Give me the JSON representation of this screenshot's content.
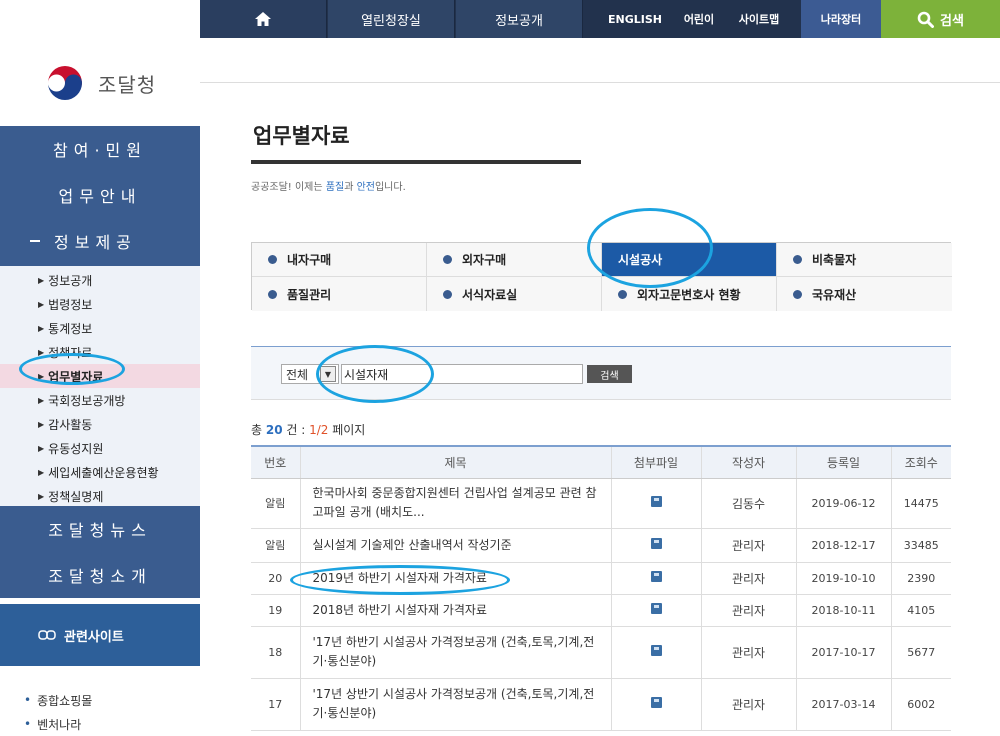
{
  "topbar": {
    "tabs": [
      "열린청장실",
      "정보공개"
    ],
    "links": [
      "ENGLISH",
      "어린이",
      "사이트맵"
    ],
    "narajangteo": "나라장터",
    "search": "검색"
  },
  "sidebar": {
    "logo_text": "조달청",
    "main_nav": [
      "참여·민원",
      "업무안내",
      "정보제공"
    ],
    "sub_items": [
      "정보공개",
      "법령정보",
      "통계정보",
      "정책자료",
      "업무별자료",
      "국회정보공개방",
      "감사활동",
      "유동성지원",
      "세입세출예산운용현황",
      "정책실명제"
    ],
    "bottom_nav": [
      "조달청뉴스",
      "조달청소개"
    ],
    "related_label": "관련사이트",
    "related_items": [
      "종합쇼핑몰",
      "벤처나라"
    ]
  },
  "main": {
    "title": "업무별자료",
    "slogan_pre": "공공조달! 이제는 ",
    "slogan_h1": "품질",
    "slogan_mid": "과 ",
    "slogan_h2": "안전",
    "slogan_post": "입니다.",
    "tabs": [
      "내자구매",
      "외자구매",
      "시설공사",
      "비축물자",
      "품질관리",
      "서식자료실",
      "외자고문변호사 현황",
      "국유재산"
    ],
    "search": {
      "select_value": "전체",
      "keyword": "시설자재",
      "button": "검색"
    },
    "count": {
      "pre": "총 ",
      "total": "20",
      "mid": " 건 : ",
      "page": "1/2",
      "post": " 페이지"
    },
    "table": {
      "headers": [
        "번호",
        "제목",
        "첨부파일",
        "작성자",
        "등록일",
        "조회수"
      ],
      "rows": [
        {
          "no": "알림",
          "title": "한국마사회 중문종합지원센터 건립사업 설계공모 관련 참고파일 공개 (배치도...",
          "writer": "김동수",
          "date": "2019-06-12",
          "views": "14475"
        },
        {
          "no": "알림",
          "title": "실시설계 기술제안 산출내역서 작성기준",
          "writer": "관리자",
          "date": "2018-12-17",
          "views": "33485"
        },
        {
          "no": "20",
          "title": "2019년 하반기 시설자재 가격자료",
          "writer": "관리자",
          "date": "2019-10-10",
          "views": "2390"
        },
        {
          "no": "19",
          "title": "2018년 하반기 시설자재 가격자료",
          "writer": "관리자",
          "date": "2018-10-11",
          "views": "4105"
        },
        {
          "no": "18",
          "title": "'17년 하반기 시설공사 가격정보공개 (건축,토목,기계,전기·통신분야)",
          "writer": "관리자",
          "date": "2017-10-17",
          "views": "5677"
        },
        {
          "no": "17",
          "title": "'17년 상반기 시설공사 가격정보공개 (건축,토목,기계,전기·통신분야)",
          "writer": "관리자",
          "date": "2017-03-14",
          "views": "6002"
        }
      ]
    }
  },
  "colors": {
    "nav_blue": "#3a5c8f",
    "active_tab": "#1c5aa6",
    "search_green": "#7db23a",
    "annotation": "#1ca3e0"
  }
}
